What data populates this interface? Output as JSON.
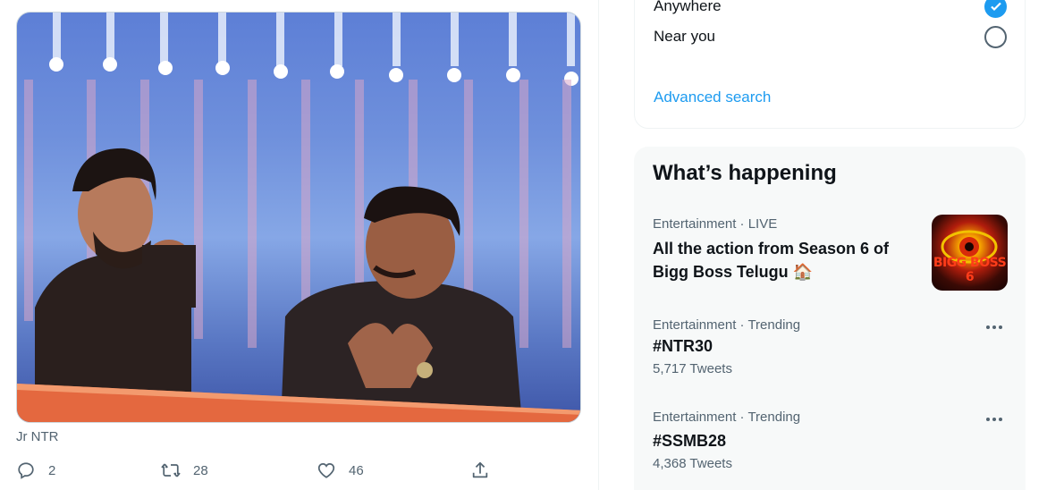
{
  "tweet": {
    "media_alt": "Jr NTR photo",
    "caption": "Jr NTR",
    "actions": {
      "reply_count": "2",
      "retweet_count": "28",
      "like_count": "46"
    }
  },
  "search_filters": {
    "location_options": [
      {
        "label": "Anywhere",
        "checked": true
      },
      {
        "label": "Near you",
        "checked": false
      }
    ],
    "advanced_search_label": "Advanced search"
  },
  "whats_happening": {
    "title": "What’s happening",
    "trends": [
      {
        "meta": "Entertainment · LIVE",
        "title": "All the action from Season 6 of Bigg Boss Telugu 🏠",
        "image_label": "BIGG BOSS 6"
      },
      {
        "meta": "Entertainment · Trending",
        "title": "#NTR30",
        "count": "5,717 Tweets"
      },
      {
        "meta": "Entertainment · Trending",
        "title": "#SSMB28",
        "count": "4,368 Tweets"
      }
    ]
  },
  "colors": {
    "accent": "#1d9bf0",
    "secondary_text": "#536471",
    "panel_bg": "#f7f9f9"
  },
  "icons": [
    "reply-icon",
    "retweet-icon",
    "like-icon",
    "share-icon",
    "checkmark-icon",
    "more-icon"
  ]
}
